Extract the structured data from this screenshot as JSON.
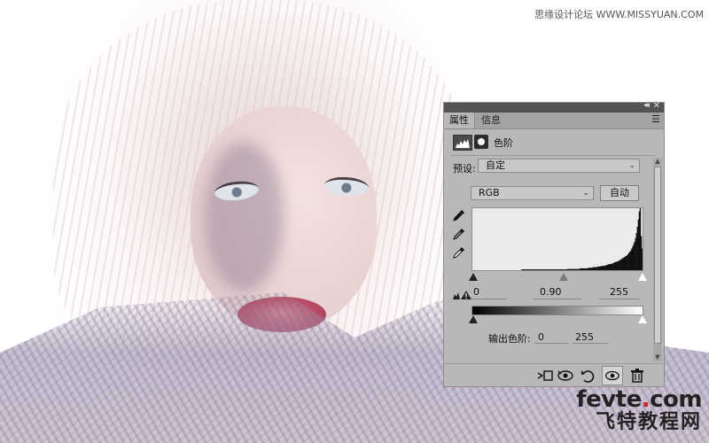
{
  "watermark": {
    "top": "思缘设计论坛 WWW.MISSYUAN.COM",
    "brand_prefix": "fevte",
    "brand_dot": ".",
    "brand_suffix": "com",
    "brand_cn": "飞特教程网"
  },
  "panel": {
    "tabs": [
      {
        "label": "属性",
        "active": true
      },
      {
        "label": "信息",
        "active": false
      }
    ],
    "menu_glyph": "☰",
    "collapse_glyph": "◂◂",
    "close_glyph": "✕",
    "adjustment_title": "色阶",
    "preset": {
      "label": "预设:",
      "value": "自定"
    },
    "channel": {
      "value": "RGB"
    },
    "auto_label": "自动",
    "input_levels": {
      "black": "0",
      "gamma": "0.90",
      "white": "255"
    },
    "output_levels": {
      "label": "输出色阶:",
      "black": "0",
      "white": "255"
    },
    "icons": {
      "adjustment": "levels-histogram-icon",
      "mask": "layer-mask-icon",
      "black_picker": "black-point-eyedropper-icon",
      "gray_picker": "gray-point-eyedropper-icon",
      "white_picker": "white-point-eyedropper-icon",
      "warning": "clipping-warning-icon",
      "clip": "clip-to-layer-icon",
      "prev_state": "view-previous-state-icon",
      "reset": "reset-icon",
      "visibility": "eye-icon",
      "delete": "trash-icon"
    }
  },
  "histogram_profile": [
    0,
    0,
    0,
    0,
    0,
    0,
    0,
    0,
    0,
    0,
    0,
    0,
    0,
    0,
    0,
    0,
    0,
    0,
    0,
    0,
    0,
    0,
    0,
    0,
    0,
    0,
    0,
    0,
    0,
    0,
    0,
    0,
    0,
    0,
    0,
    0,
    0,
    0,
    0,
    0,
    0,
    0,
    0,
    0,
    0,
    0,
    0,
    0,
    0,
    0,
    0,
    0,
    0.01,
    0.01,
    0.01,
    0.01,
    0.01,
    0.01,
    0.01,
    0.01,
    0.01,
    0.01,
    0.01,
    0.01,
    0.01,
    0.01,
    0.01,
    0.01,
    0.01,
    0.01,
    0.01,
    0.01,
    0.01,
    0.01,
    0.01,
    0.01,
    0.01,
    0.01,
    0.01,
    0.01,
    0.01,
    0.01,
    0.01,
    0.01,
    0.01,
    0.01,
    0.01,
    0.01,
    0.01,
    0.01,
    0.01,
    0.01,
    0.01,
    0.01,
    0.01,
    0.01,
    0.01,
    0.01,
    0.01,
    0.01,
    0.01,
    0.02,
    0.02,
    0.02,
    0.02,
    0.02,
    0.02,
    0.02,
    0.02,
    0.02,
    0.02,
    0.02,
    0.02,
    0.02,
    0.03,
    0.03,
    0.03,
    0.03,
    0.03,
    0.03,
    0.03,
    0.03,
    0.03,
    0.04,
    0.04,
    0.04,
    0.04,
    0.04,
    0.05,
    0.05,
    0.05,
    0.05,
    0.05,
    0.06,
    0.06,
    0.06,
    0.06,
    0.07,
    0.07,
    0.07,
    0.07,
    0.08,
    0.08,
    0.09,
    0.09,
    0.1,
    0.1,
    0.1,
    0.11,
    0.11,
    0.12,
    0.13,
    0.13,
    0.14,
    0.14,
    0.15,
    0.16,
    0.17,
    0.18,
    0.19,
    0.2,
    0.21,
    0.22,
    0.23,
    0.24,
    0.26,
    0.28,
    0.3,
    0.32,
    0.35,
    0.38,
    0.42,
    0.46,
    0.52,
    0.6,
    0.7,
    0.82,
    0.95,
    1.0,
    0.55,
    0.35
  ]
}
